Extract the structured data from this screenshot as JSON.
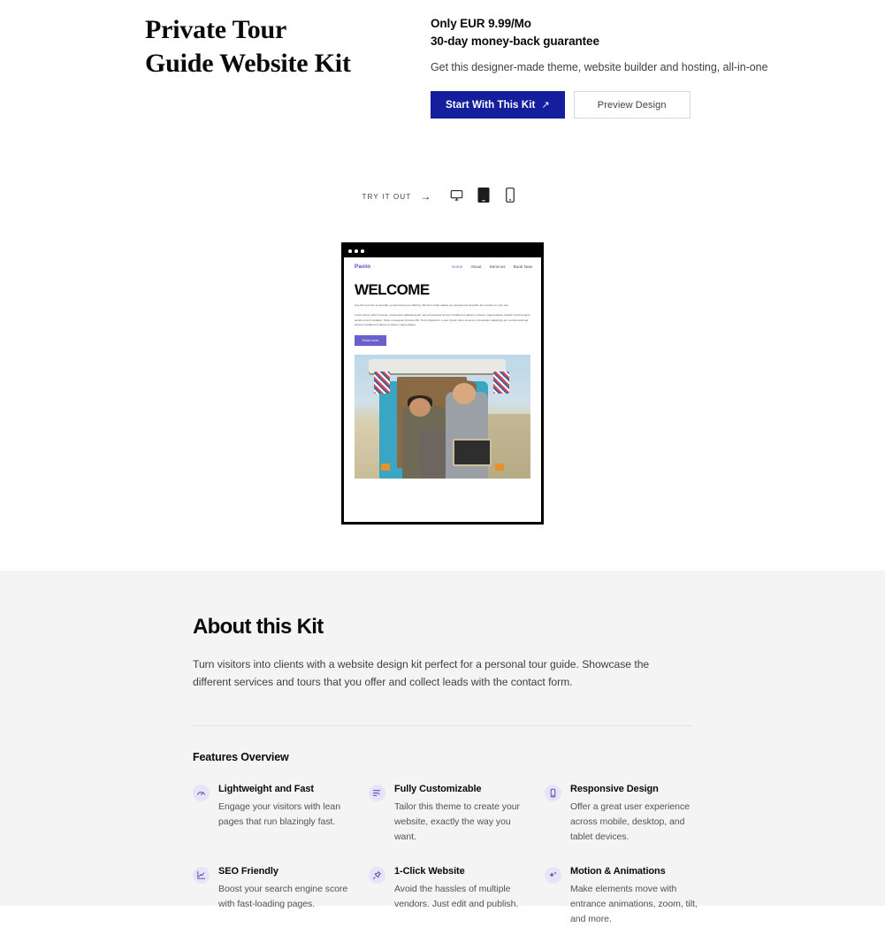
{
  "hero": {
    "title_line1": "Private Tour",
    "title_line2": "Guide Website Kit",
    "price": "Only EUR 9.99/Mo",
    "guarantee": "30-day money-back guarantee",
    "subtitle": "Get this designer-made theme, website builder and hosting, all-in-one",
    "primary_button": "Start With This Kit",
    "primary_button_arrow": "↗",
    "secondary_button": "Preview Design"
  },
  "tryout": {
    "label": "TRY IT OUT",
    "arrow": "→",
    "devices": [
      {
        "name": "desktop",
        "active": false
      },
      {
        "name": "tablet",
        "active": true
      },
      {
        "name": "mobile",
        "active": false
      }
    ]
  },
  "preview": {
    "site": {
      "logo": "Paolo",
      "nav": [
        {
          "label": "Home",
          "active": true
        },
        {
          "label": "About",
          "active": false
        },
        {
          "label": "Services",
          "active": false
        },
        {
          "label": "Book Now",
          "active": false
        }
      ],
      "heading": "WELCOME",
      "paragraph1": "Use this text box to describe yourself and your offering. Tell them what makes you special and describe the content on your site.",
      "paragraph2": "Lorem ipsum dolor sit amet, consectetur adipiscing elit, sed do eiusmod tempor incididunt ut labore et dolore magna aliqua. Facilisi morbi tempus iaculis urna id volutpat. Tortor consequat id porta nibh. Tortor dignissim. Lorem ipsum dolor sit amet, consectetur adipiscing elit, sed do eiusmod tempor incididunt ut labore et dolore magna aliqua.",
      "cta": "Read more",
      "image_alt": "Couple with a dog at the back of a blue camper van"
    }
  },
  "about": {
    "title": "About this Kit",
    "text": "Turn visitors into clients with a website design kit perfect for a personal tour guide. Showcase the different services and tours that you offer and collect leads with the contact form.",
    "features_title": "Features Overview",
    "features": [
      {
        "icon": "gauge-icon",
        "name": "Lightweight and Fast",
        "desc": "Engage your visitors with lean pages that run blazingly fast."
      },
      {
        "icon": "sliders-icon",
        "name": "Fully Customizable",
        "desc": "Tailor this theme to create your website, exactly the way you want."
      },
      {
        "icon": "mobile-icon",
        "name": "Responsive Design",
        "desc": "Offer a great user experience across mobile, desktop, and tablet devices."
      },
      {
        "icon": "chart-line-icon",
        "name": "SEO Friendly",
        "desc": "Boost your search engine score with fast-loading pages."
      },
      {
        "icon": "pin-icon",
        "name": "1-Click Website",
        "desc": "Avoid the hassles of multiple vendors. Just edit and publish."
      },
      {
        "icon": "sparkle-icon",
        "name": "Motion & Animations",
        "desc": "Make elements move with entrance animations, zoom, tilt, and more."
      }
    ]
  },
  "colors": {
    "primary_button": "#151E9C",
    "accent_purple": "#6B5FCC",
    "icon_bg": "#E7E3F8",
    "section_bg": "#F4F4F5"
  }
}
